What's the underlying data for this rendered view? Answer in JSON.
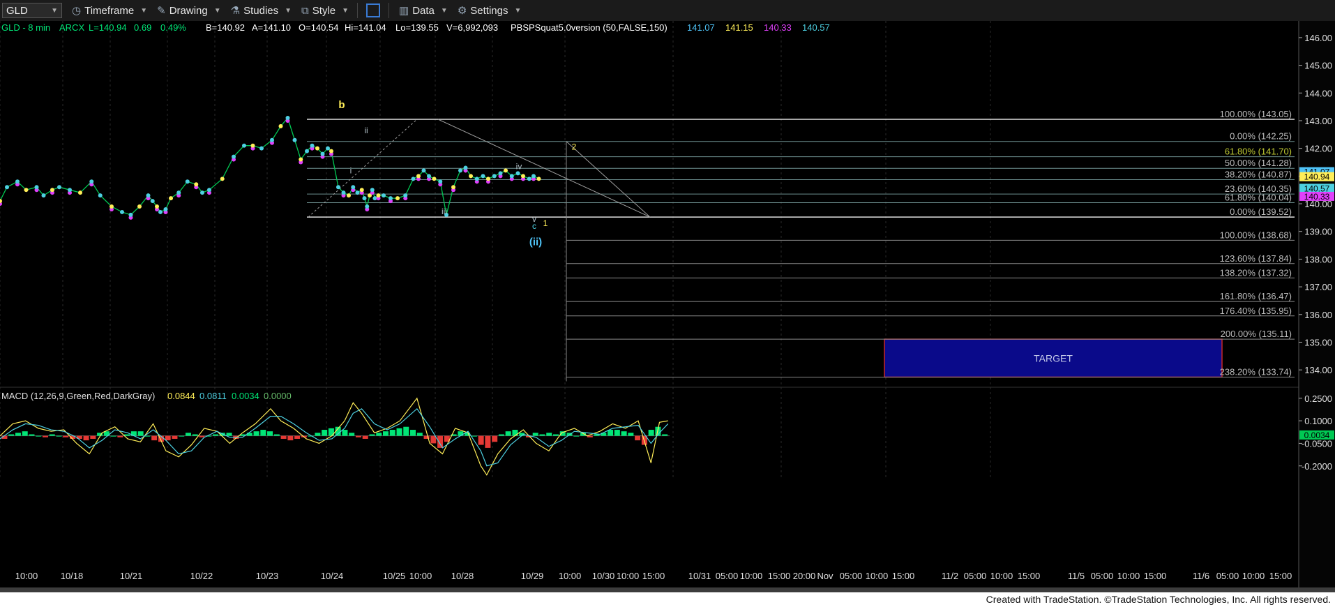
{
  "toolbar": {
    "symbol": "GLD",
    "timeframe": "Timeframe",
    "drawing": "Drawing",
    "studies": "Studies",
    "style": "Style",
    "data": "Data",
    "settings": "Settings"
  },
  "quote_bar": [
    {
      "text": "GLD - 8 min",
      "color": "#00e676"
    },
    {
      "text": "ARCX",
      "color": "#00e676"
    },
    {
      "text": "L=140.94",
      "color": "#00e676"
    },
    {
      "text": "0.69",
      "color": "#00e676"
    },
    {
      "text": "0.49%",
      "color": "#00e676"
    },
    {
      "text": "B=140.92",
      "color": "#ffffff"
    },
    {
      "text": "A=141.10",
      "color": "#ffffff"
    },
    {
      "text": "O=140.54",
      "color": "#ffffff"
    },
    {
      "text": "Hi=141.04",
      "color": "#ffffff"
    },
    {
      "text": "Lo=139.55",
      "color": "#ffffff"
    },
    {
      "text": "V=6,992,093",
      "color": "#ffffff"
    },
    {
      "text": "PBSPSquat5.0version (50,FALSE,150)",
      "color": "#ffffff"
    },
    {
      "text": "141.07",
      "color": "#4fc3f7"
    },
    {
      "text": "141.15",
      "color": "#ffee58"
    },
    {
      "text": "140.33",
      "color": "#e040fb"
    },
    {
      "text": "140.57",
      "color": "#4dd0e1"
    }
  ],
  "chart_data": [
    {
      "type": "line",
      "title": "",
      "ylim": [
        133.5,
        146.3
      ],
      "y_ticks": [
        "146.00",
        "145.00",
        "144.00",
        "143.00",
        "142.00",
        "141.00",
        "140.00",
        "139.00",
        "138.00",
        "137.00",
        "136.00",
        "135.00",
        "134.00"
      ],
      "x_ticks": [
        "10:00",
        "10/18",
        "10/21",
        "10/22",
        "10/23",
        "10/24",
        "10/25",
        "10:00",
        "10/28",
        "10/29",
        "10:00",
        "10/30",
        "10:00",
        "15:00",
        "10/31",
        "05:00",
        "10:00",
        "15:00",
        "20:00",
        "Nov",
        "05:00",
        "10:00",
        "15:00",
        "11/2",
        "05:00",
        "10:00",
        "15:00",
        "11/5",
        "05:00",
        "10:00",
        "15:00",
        "11/6",
        "05:00",
        "10:00",
        "15:00"
      ],
      "price_series": {
        "x": [
          0,
          8,
          20,
          30,
          42,
          50,
          60,
          68,
          80,
          92,
          105,
          115,
          128,
          140,
          150,
          160,
          170,
          175,
          180,
          184,
          190,
          196,
          205,
          215,
          225,
          232,
          240,
          255,
          268,
          280,
          290,
          300,
          312,
          322,
          330,
          338,
          345,
          352,
          358,
          364,
          370,
          376,
          380,
          388,
          394,
          400,
          405,
          410,
          415,
          418,
          421,
          424,
          427,
          430,
          434,
          440,
          448,
          456,
          465,
          474,
          480,
          486,
          492,
          498,
          505,
          512,
          520,
          528,
          534,
          540,
          547,
          554,
          560,
          567,
          574,
          580,
          587,
          594,
          600,
          607,
          612,
          618
        ],
        "y": [
          140.1,
          140.6,
          140.8,
          140.5,
          140.6,
          140.3,
          140.5,
          140.6,
          140.5,
          140.4,
          140.8,
          140.3,
          139.9,
          139.7,
          139.6,
          139.9,
          140.3,
          140.1,
          139.9,
          139.7,
          139.8,
          140.2,
          140.4,
          140.8,
          140.7,
          140.4,
          140.5,
          140.9,
          141.7,
          142.1,
          142.1,
          142.0,
          142.3,
          142.8,
          143.1,
          142.3,
          141.6,
          141.9,
          142.1,
          142.0,
          141.8,
          142.0,
          141.9,
          140.6,
          140.4,
          140.3,
          140.6,
          140.4,
          140.5,
          140.2,
          139.9,
          140.3,
          140.5,
          140.2,
          140.3,
          140.3,
          140.2,
          140.2,
          140.3,
          140.9,
          141.0,
          141.2,
          141.0,
          140.9,
          140.8,
          139.6,
          140.6,
          141.2,
          141.3,
          141.0,
          140.9,
          141.0,
          140.9,
          141.0,
          141.1,
          141.2,
          141.0,
          141.1,
          141.0,
          140.9,
          141.0,
          140.9
        ]
      },
      "price_labels": [
        {
          "text": "141.07",
          "value": 141.07,
          "color": "#4fc3f7"
        },
        {
          "text": "140.94",
          "value": 140.94,
          "color": "#ffee58"
        },
        {
          "text": "140.57",
          "value": 140.57,
          "color": "#4dd0e1"
        },
        {
          "text": "140.33",
          "value": 140.33,
          "color": "#e040fb"
        }
      ],
      "fib_levels_top": [
        {
          "label": "100.00% (143.05)",
          "value": 143.05
        },
        {
          "label": "0.00% (142.25)",
          "value": 142.25
        },
        {
          "label": "61.80% (141.70)",
          "value": 141.7
        },
        {
          "label": "50.00% (141.28)",
          "value": 141.28
        },
        {
          "label": "38.20% (140.87)",
          "value": 140.87
        },
        {
          "label": "23.60% (140.35)",
          "value": 140.35
        },
        {
          "label": "61.80% (140.04)",
          "value": 140.04
        },
        {
          "label": "0.00% (139.52)",
          "value": 139.52
        }
      ],
      "fib_levels_extension": [
        {
          "label": "100.00% (138.68)",
          "value": 138.68
        },
        {
          "label": "123.60% (137.84)",
          "value": 137.84
        },
        {
          "label": "138.20% (137.32)",
          "value": 137.32
        },
        {
          "label": "161.80% (136.47)",
          "value": 136.47
        },
        {
          "label": "176.40% (135.95)",
          "value": 135.95
        },
        {
          "label": "200.00% (135.11)",
          "value": 135.11
        },
        {
          "label": "238.20% (133.74)",
          "value": 133.74
        }
      ],
      "wave_labels": [
        {
          "text": "b",
          "x": 490,
          "value": 143.45,
          "color": "#ffee58"
        },
        {
          "text": "ii",
          "x": 525,
          "value": 142.55,
          "color": "#b0bec5"
        },
        {
          "text": "i",
          "x": 503,
          "value": 141.1,
          "color": "#b0bec5"
        },
        {
          "text": "iii",
          "x": 637,
          "value": 139.62,
          "color": "#b0bec5"
        },
        {
          "text": "iv",
          "x": 744,
          "value": 141.25,
          "color": "#b0bec5"
        },
        {
          "text": "v",
          "x": 766,
          "value": 139.35,
          "color": "#b0bec5"
        },
        {
          "text": "c",
          "x": 766,
          "value": 139.1,
          "color": "#4dd0e1"
        },
        {
          "text": "1",
          "x": 782,
          "value": 139.2,
          "color": "#ffee58"
        },
        {
          "text": "(ii)",
          "x": 768,
          "value": 138.5,
          "color": "#4fc3f7"
        },
        {
          "text": "2",
          "x": 823,
          "value": 141.95,
          "color": "#ffee58"
        }
      ],
      "target": {
        "label": "TARGET",
        "y_top": 135.11,
        "y_bottom": 133.74
      }
    },
    {
      "type": "line",
      "title": "MACD (12,26,9,Green,Red,DarkGray)",
      "readouts": [
        {
          "text": "0.0844",
          "color": "#ffee58"
        },
        {
          "text": "0.0811",
          "color": "#4dd0e1"
        },
        {
          "text": "0.0034",
          "color": "#00e676"
        },
        {
          "text": "0.0000",
          "color": "#66bb6a"
        }
      ],
      "ylim": [
        -0.28,
        0.3
      ],
      "y_ticks": [
        "0.2500",
        "0.1000",
        "-0.0500",
        "-0.2000"
      ],
      "current": {
        "text": "0.0034",
        "value": 0.0034
      },
      "macd": {
        "x": [
          0,
          15,
          30,
          45,
          60,
          75,
          90,
          105,
          120,
          135,
          150,
          165,
          180,
          195,
          210,
          225,
          240,
          255,
          270,
          285,
          300,
          318,
          330,
          345,
          360,
          375,
          390,
          405,
          415,
          425,
          440,
          455,
          470,
          490,
          505,
          520,
          535,
          550,
          565,
          572,
          585,
          600,
          615,
          630,
          645,
          660,
          675,
          690,
          705,
          720,
          735,
          750,
          765,
          775,
          785
        ],
        "y": [
          0.0,
          0.08,
          0.1,
          0.05,
          0.03,
          0.04,
          -0.05,
          -0.12,
          0.02,
          0.06,
          -0.02,
          -0.04,
          0.08,
          -0.1,
          -0.14,
          -0.06,
          0.05,
          0.03,
          -0.05,
          0.02,
          0.08,
          0.18,
          0.1,
          0.05,
          -0.02,
          -0.05,
          0.0,
          0.1,
          0.22,
          0.15,
          0.02,
          0.05,
          0.1,
          0.25,
          -0.05,
          -0.12,
          0.05,
          0.02,
          -0.2,
          -0.26,
          -0.12,
          -0.02,
          0.04,
          -0.05,
          -0.1,
          0.02,
          0.05,
          0.0,
          0.03,
          0.08,
          0.05,
          0.1,
          -0.18,
          0.09,
          0.1
        ]
      },
      "signal": {
        "x": [
          0,
          15,
          30,
          45,
          60,
          75,
          90,
          105,
          120,
          135,
          150,
          165,
          180,
          195,
          210,
          225,
          240,
          255,
          270,
          285,
          300,
          318,
          330,
          345,
          360,
          375,
          390,
          405,
          415,
          425,
          440,
          455,
          470,
          490,
          505,
          520,
          535,
          550,
          565,
          572,
          585,
          600,
          615,
          630,
          645,
          660,
          675,
          690,
          705,
          720,
          735,
          750,
          765,
          775,
          785
        ],
        "y": [
          -0.02,
          0.04,
          0.08,
          0.07,
          0.04,
          0.03,
          -0.01,
          -0.08,
          -0.03,
          0.04,
          0.02,
          -0.02,
          0.04,
          -0.03,
          -0.12,
          -0.1,
          -0.01,
          0.03,
          -0.01,
          -0.01,
          0.05,
          0.13,
          0.13,
          0.08,
          0.02,
          -0.03,
          -0.02,
          0.05,
          0.15,
          0.18,
          0.08,
          0.04,
          0.08,
          0.18,
          0.06,
          -0.08,
          -0.02,
          0.03,
          -0.1,
          -0.2,
          -0.18,
          -0.06,
          0.01,
          -0.01,
          -0.07,
          -0.03,
          0.03,
          0.02,
          0.01,
          0.05,
          0.06,
          0.07,
          -0.05,
          0.02,
          0.08
        ]
      },
      "histogram": {
        "x": [
          2,
          10,
          18,
          26,
          34,
          42,
          50,
          58,
          66,
          74,
          82,
          90,
          98,
          106,
          114,
          122,
          130,
          138,
          146,
          154,
          162,
          170,
          178,
          186,
          194,
          202,
          210,
          218,
          226,
          234,
          242,
          250,
          258,
          266,
          274,
          282,
          290,
          298,
          306,
          314,
          322,
          330,
          338,
          346,
          354,
          362,
          370,
          378,
          386,
          394,
          402,
          410,
          418,
          426,
          434,
          442,
          450,
          458,
          466,
          474,
          482,
          490,
          498,
          506,
          514,
          522,
          530,
          538,
          546,
          554,
          562,
          570,
          578,
          586,
          594,
          602,
          610,
          618,
          626,
          634,
          642,
          650,
          658,
          666,
          674,
          682,
          690,
          698,
          706,
          714,
          722,
          730,
          738,
          746,
          754,
          762,
          770,
          778
        ],
        "y": [
          -0.02,
          0.01,
          0.02,
          0.03,
          0.01,
          0.0,
          -0.01,
          0.01,
          0.0,
          -0.01,
          -0.02,
          -0.02,
          -0.03,
          -0.02,
          0.02,
          0.03,
          0.0,
          -0.01,
          0.01,
          0.03,
          0.03,
          0.0,
          -0.03,
          -0.04,
          -0.03,
          -0.02,
          0.0,
          0.02,
          0.01,
          -0.01,
          0.0,
          0.01,
          0.02,
          0.02,
          -0.02,
          0.01,
          0.02,
          0.03,
          0.04,
          0.03,
          0.01,
          -0.02,
          -0.03,
          -0.02,
          -0.01,
          0.0,
          0.02,
          0.04,
          0.05,
          0.06,
          0.04,
          0.02,
          -0.01,
          -0.02,
          0.01,
          0.02,
          0.03,
          0.04,
          0.05,
          0.06,
          0.04,
          0.02,
          -0.02,
          -0.05,
          -0.08,
          -0.04,
          0.01,
          0.03,
          0.02,
          0.0,
          -0.06,
          -0.08,
          -0.04,
          0.01,
          0.03,
          0.04,
          0.02,
          -0.01,
          0.02,
          0.01,
          0.02,
          0.01,
          0.03,
          0.02,
          0.0,
          0.02,
          -0.01,
          0.01,
          0.02,
          0.04,
          0.04,
          0.03,
          0.02,
          -0.03,
          -0.06,
          0.04,
          0.06,
          0.01
        ]
      }
    }
  ],
  "footer": "Created with TradeStation. ©TradeStation Technologies, Inc. All rights reserved.",
  "colors": {
    "price": "#00c853",
    "macd": "#ffee58",
    "signal": "#4dd0e1",
    "hist_pos": "#00e676",
    "hist_neg": "#e53935",
    "target_fill": "#0a0a8a",
    "target_border": "#c62828",
    "level": "#9e9e9e"
  }
}
